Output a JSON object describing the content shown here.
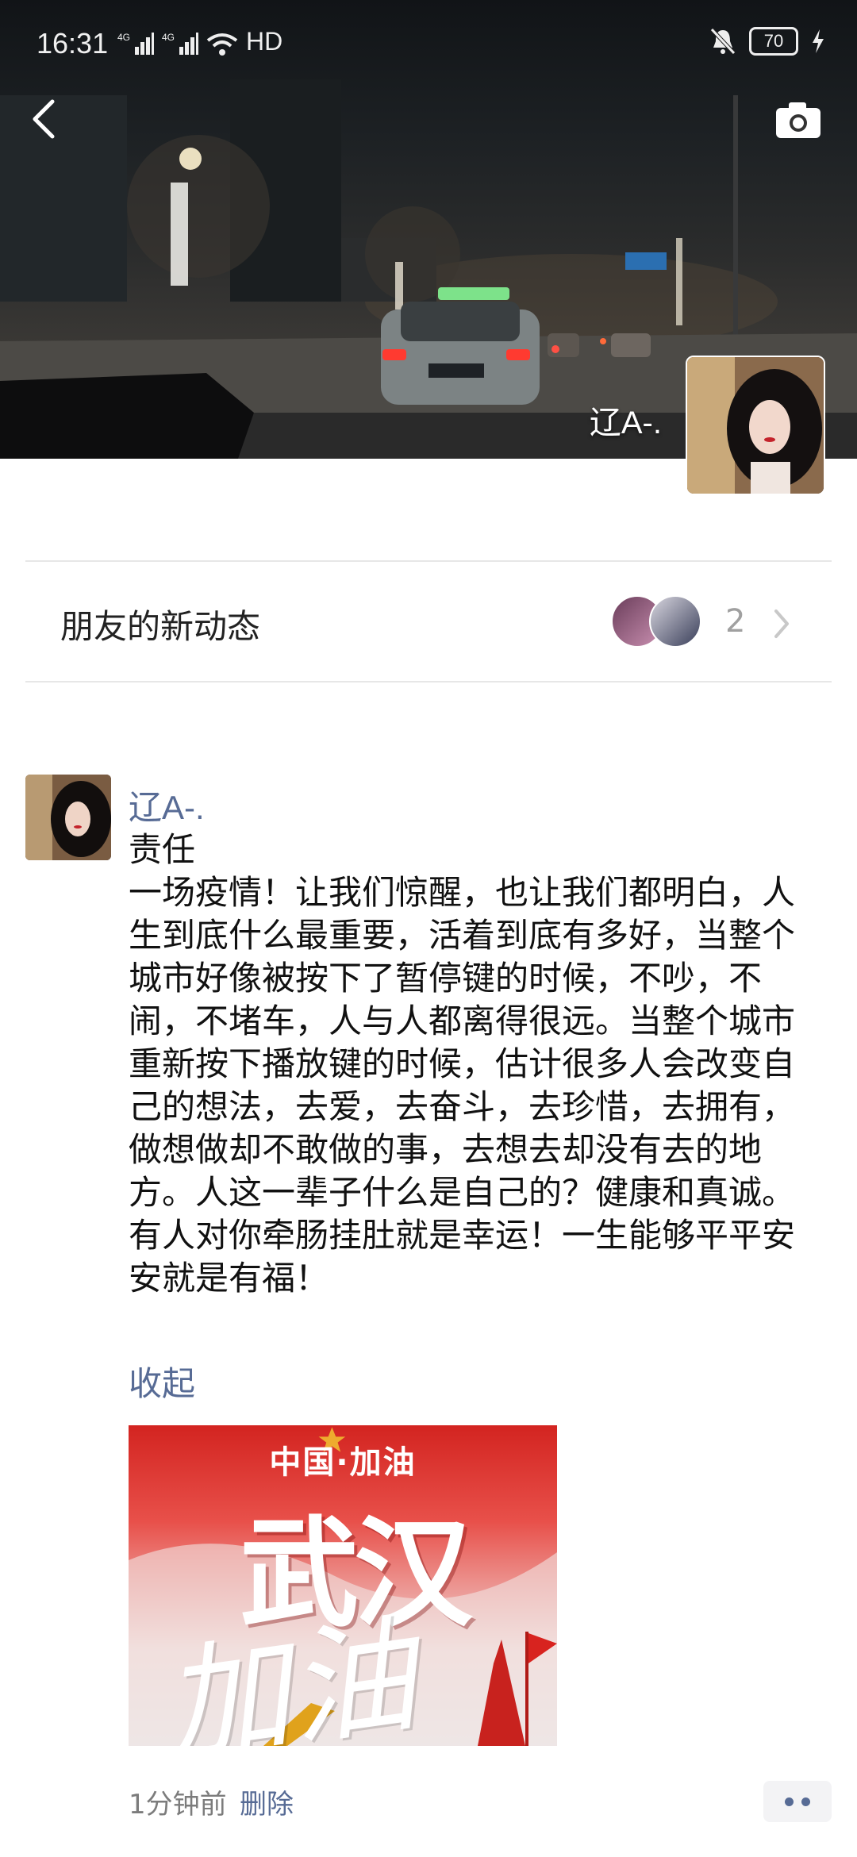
{
  "status_bar": {
    "time": "16:31",
    "network_left": [
      "4G",
      "4G"
    ],
    "wifi_label": "HD",
    "battery": "70",
    "icons": [
      "signal-icon",
      "signal-icon",
      "wifi-icon",
      "mute-icon",
      "battery-icon",
      "charging-icon"
    ]
  },
  "cover": {
    "username": "辽A-.",
    "icons": [
      "back-icon",
      "camera-icon"
    ]
  },
  "friends_updates": {
    "label": "朋友的新动态",
    "count": "2",
    "icon": "chevron-right-icon"
  },
  "post": {
    "author": "辽A-.",
    "text": "责任\n一场疫情！让我们惊醒，也让我们都明白，人生到底什么最重要，活着到底有多好，当整个城市好像被按下了暂停键的时候，不吵，不闹，不堵车，人与人都离得很远。当整个城市重新按下播放键的时候，估计很多人会改变自己的想法，去爱，去奋斗，去珍惜，去拥有，做想做却不敢做的事，去想去却没有去的地方。人这一辈子什么是自己的？健康和真诚。有人对你牵肠挂肚就是幸运！一生能够平平安安就是有福！",
    "collapse_label": "收起",
    "image": {
      "top_text": "中国·加油",
      "big_text": "武汉",
      "script_text": "加油"
    },
    "time_ago": "1分钟前",
    "delete_label": "删除",
    "more_icon": "more-dots-icon"
  },
  "colors": {
    "link": "#576b95",
    "meta": "#7c7c7c",
    "divider": "#e7e7e7"
  }
}
